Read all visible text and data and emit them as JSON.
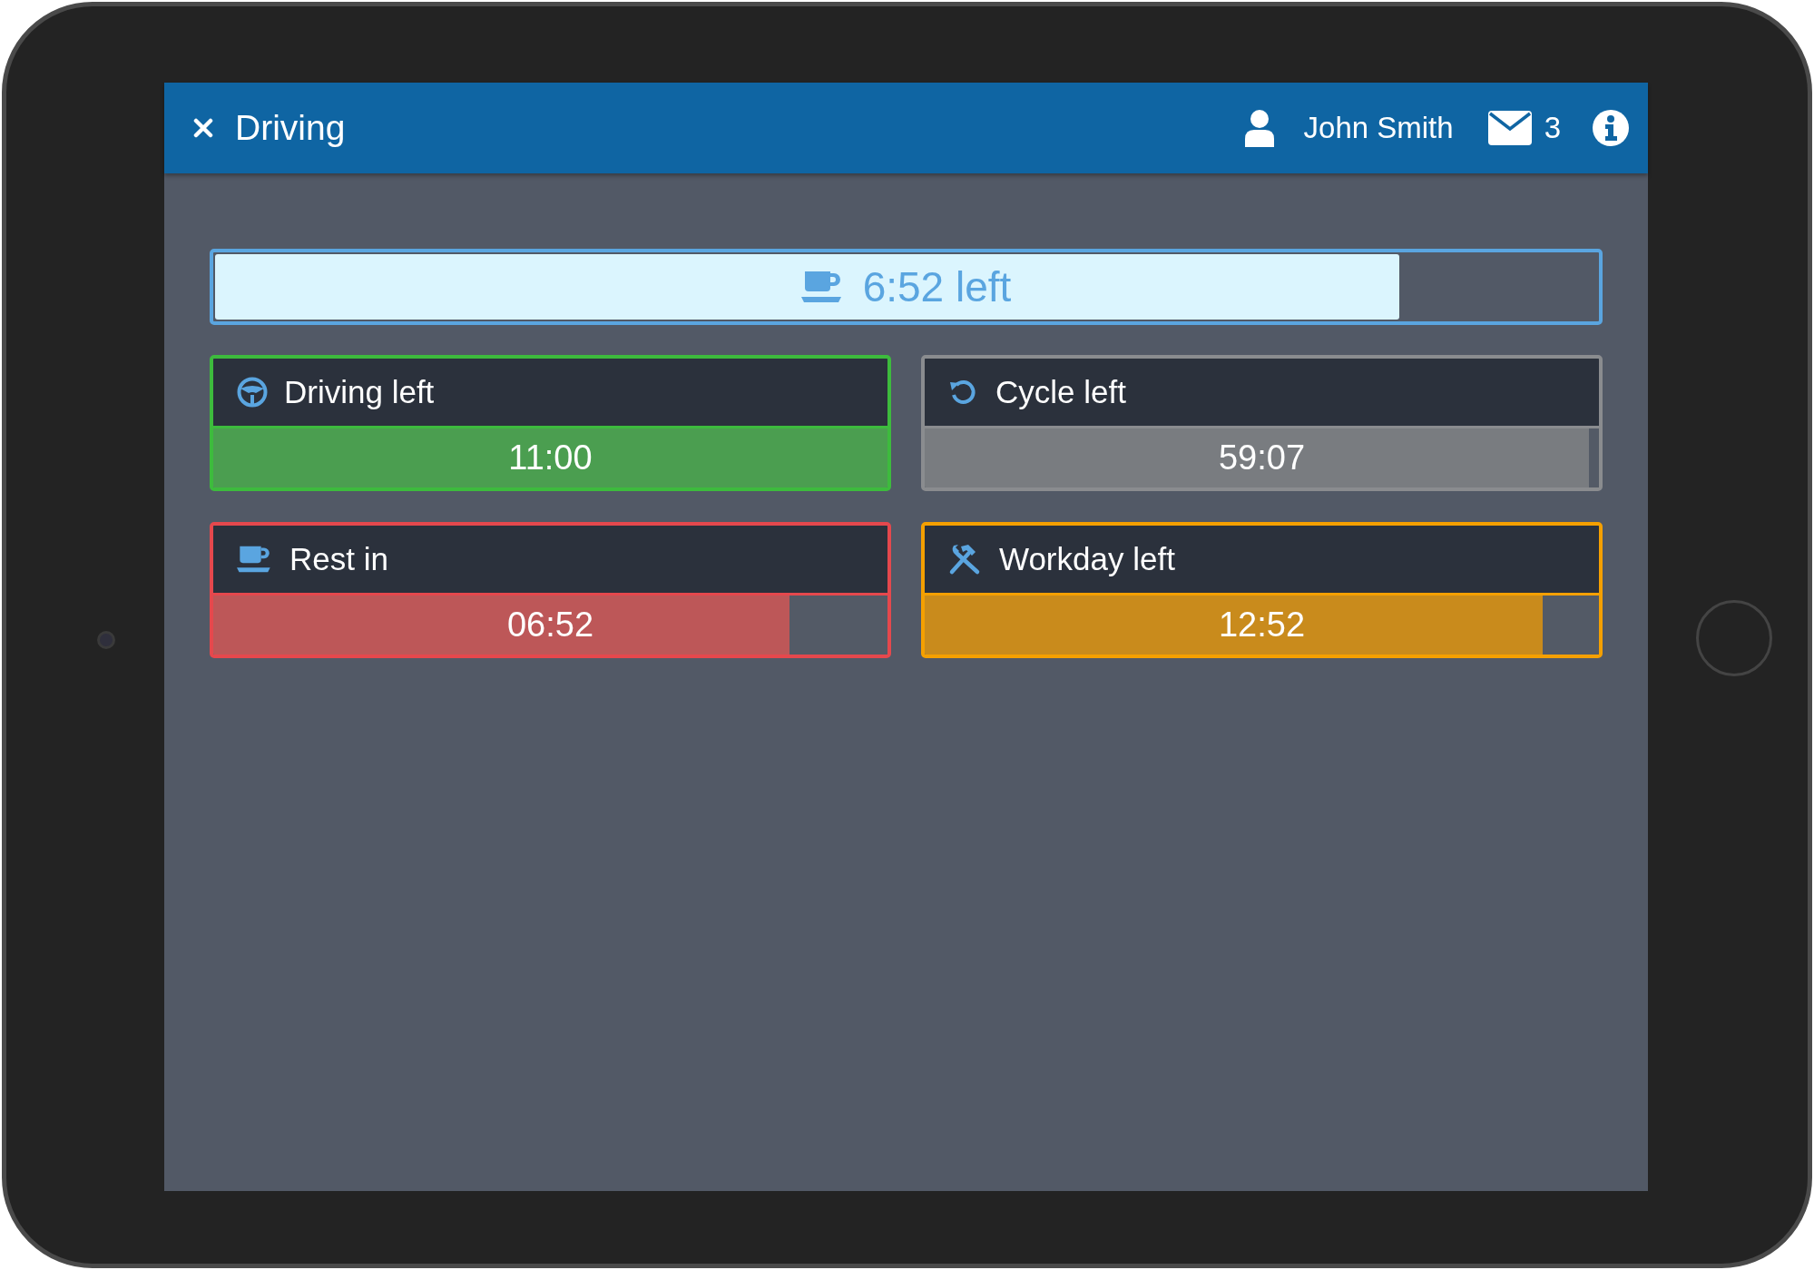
{
  "header": {
    "title": "Driving",
    "user": "John Smith",
    "message_count": "3"
  },
  "break_bar": {
    "text": "6:52 left",
    "level": 0.857
  },
  "cards": [
    {
      "kind": "driving",
      "label": "Driving left",
      "value": "11:00",
      "level": 1.0,
      "color": "#3dbb3d"
    },
    {
      "kind": "cycle",
      "label": "Cycle left",
      "value": "59:07",
      "level": 0.985,
      "color": "#8a8c8f"
    },
    {
      "kind": "rest",
      "label": "Rest in",
      "value": "06:52",
      "level": 0.855,
      "color": "#e5484d"
    },
    {
      "kind": "workday",
      "label": "Workday left",
      "value": "12:52",
      "level": 0.917,
      "color": "#f5a000"
    }
  ]
}
